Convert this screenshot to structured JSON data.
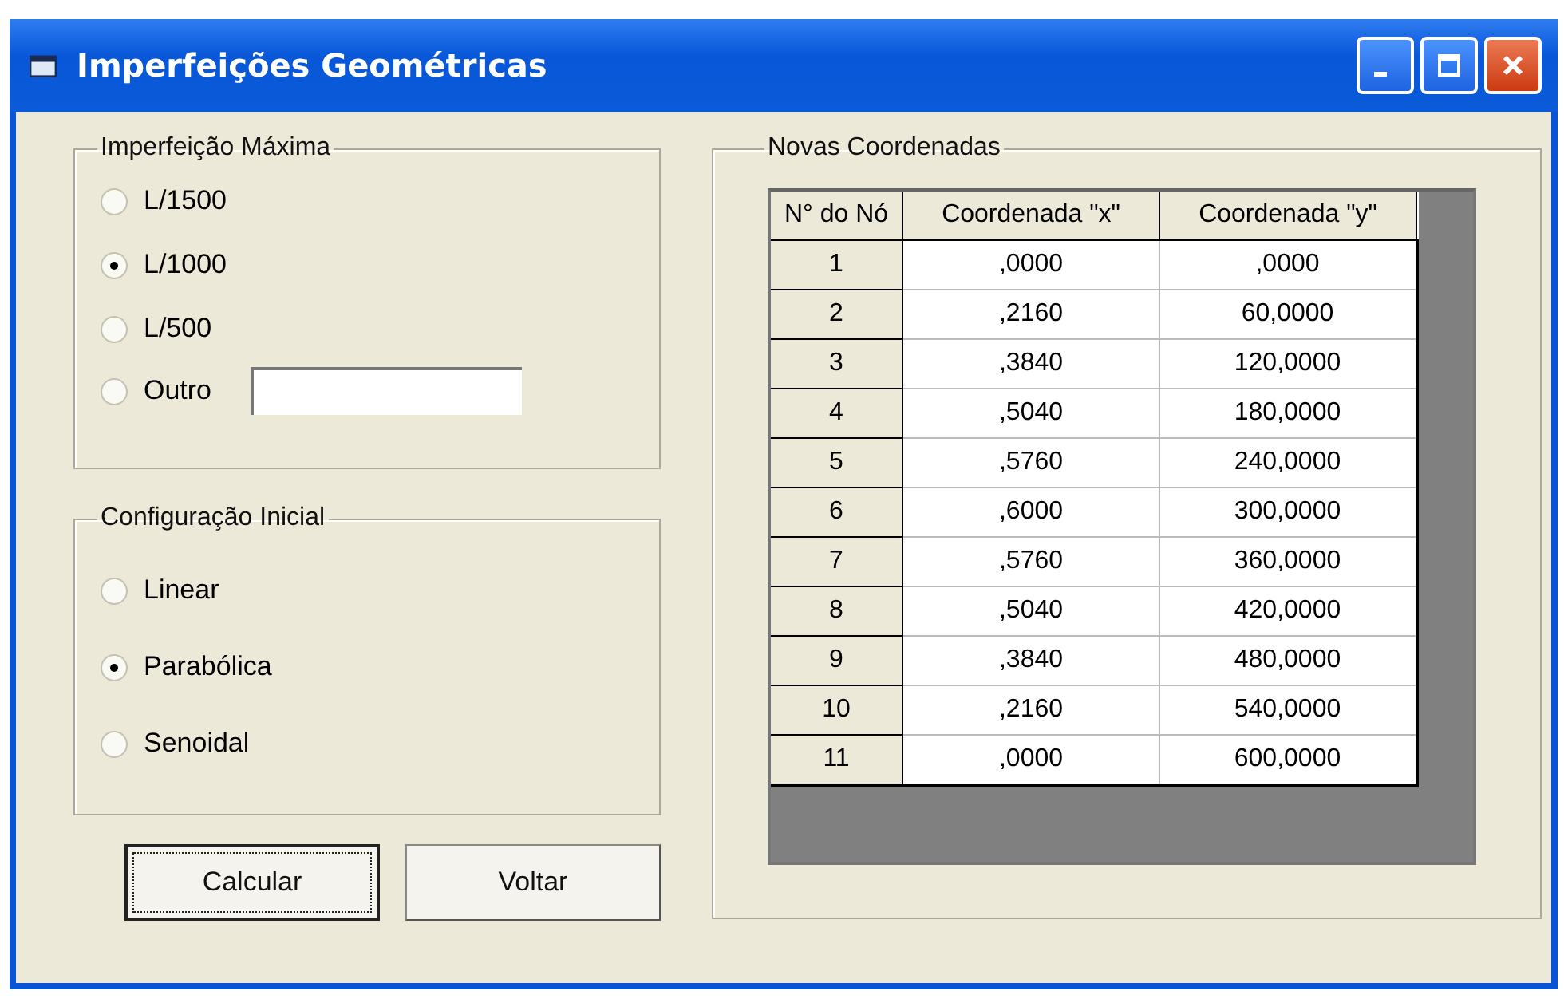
{
  "window": {
    "title": "Imperfeições Geométricas"
  },
  "max_imperfection": {
    "title": "Imperfeição Máxima",
    "options": [
      {
        "label": "L/1500",
        "selected": false
      },
      {
        "label": "L/1000",
        "selected": true
      },
      {
        "label": "L/500",
        "selected": false
      },
      {
        "label": "Outro",
        "selected": false,
        "kind": "field"
      }
    ]
  },
  "initial_configuration": {
    "title": "Configuração Inicial",
    "options": [
      {
        "label": "Linear",
        "selected": false
      },
      {
        "label": "Parabólica",
        "selected": true
      },
      {
        "label": "Senoidal",
        "selected": false
      }
    ]
  },
  "buttons": [
    {
      "label": "Calcular",
      "focused": true
    },
    {
      "label": "Voltar",
      "focused": false
    }
  ],
  "new_coordinates": {
    "title": "Novas Coordenadas",
    "table": {
      "columns": [
        "N° do Nó",
        "Coordenada \"x\"",
        "Coordenada \"y\""
      ],
      "rows": [
        [
          "1",
          ",0000",
          ",0000"
        ],
        [
          "2",
          ",2160",
          "60,0000"
        ],
        [
          "3",
          ",3840",
          "120,0000"
        ],
        [
          "4",
          ",5040",
          "180,0000"
        ],
        [
          "5",
          ",5760",
          "240,0000"
        ],
        [
          "6",
          ",6000",
          "300,0000"
        ],
        [
          "7",
          ",5760",
          "360,0000"
        ],
        [
          "8",
          ",5040",
          "420,0000"
        ],
        [
          "9",
          ",3840",
          "480,0000"
        ],
        [
          "10",
          ",2160",
          "540,0000"
        ],
        [
          "11",
          ",0000",
          "600,0000"
        ]
      ]
    }
  }
}
